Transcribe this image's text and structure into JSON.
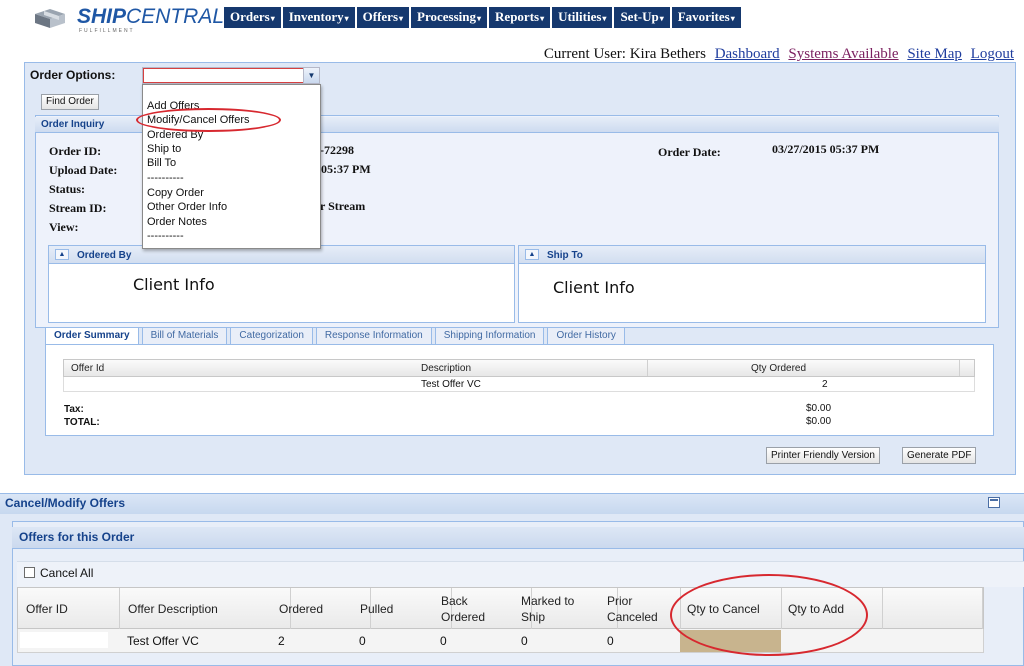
{
  "brand": {
    "name_bold": "SHIP",
    "name_light": "CENTRAL",
    "sub": "FULFILLMENT"
  },
  "nav": [
    {
      "label": "Orders"
    },
    {
      "label": "Inventory"
    },
    {
      "label": "Offers"
    },
    {
      "label": "Processing"
    },
    {
      "label": "Reports"
    },
    {
      "label": "Utilities"
    },
    {
      "label": "Set-Up"
    },
    {
      "label": "Favorites"
    }
  ],
  "userbar": {
    "label": "Current User: Kira Bethers",
    "links": [
      "Dashboard",
      "Systems Available",
      "Site Map",
      "Logout"
    ]
  },
  "order_options": {
    "label": "Order Options:",
    "value": "",
    "menu": [
      "Add Offers",
      "Modify/Cancel Offers",
      "Ordered By",
      "Ship to",
      "Bill To",
      "----------",
      "Copy Order",
      "Other Order Info",
      "Order Notes",
      "----------"
    ]
  },
  "find_order": "Find Order",
  "inquiry": {
    "title": "Order Inquiry",
    "labels": [
      "Order ID:",
      "Upload Date:",
      "Status:",
      "Stream ID:",
      "View:"
    ],
    "order_id_fragment": "-72298",
    "upload_fragment": "05:37 PM",
    "stream_fragment": "r Stream",
    "order_date_label": "Order Date:",
    "order_date": "03/27/2015 05:37 PM"
  },
  "ordered_by": {
    "title": "Ordered By",
    "content": "Client Info"
  },
  "ship_to": {
    "title": "Ship To",
    "content": "Client Info"
  },
  "tabs": [
    "Order Summary",
    "Bill of Materials",
    "Categorization",
    "Response Information",
    "Shipping Information",
    "Order History"
  ],
  "summary": {
    "columns": [
      "Offer Id",
      "Description",
      "Qty Ordered"
    ],
    "rows": [
      {
        "offer_id": "",
        "description": "Test Offer VC",
        "qty": "2"
      }
    ],
    "tax_label": "Tax:",
    "tax": "$0.00",
    "total_label": "TOTAL:",
    "total": "$0.00"
  },
  "buttons": {
    "printer": "Printer Friendly Version",
    "pdf": "Generate PDF"
  },
  "cancel_modify": {
    "title": "Cancel/Modify Offers",
    "section_title": "Offers for this Order",
    "cancel_all": "Cancel All",
    "columns": [
      "Offer ID",
      "Offer Description",
      "Ordered",
      "Pulled",
      "Back Ordered",
      "Marked to Ship",
      "Prior Canceled",
      "Qty to Cancel",
      "Qty to Add"
    ],
    "row": {
      "offer_id": "",
      "description": "Test Offer VC",
      "ordered": "2",
      "pulled": "0",
      "back_ordered": "0",
      "marked_to_ship": "0",
      "prior_canceled": "0",
      "qty_to_cancel": "",
      "qty_to_add": ""
    }
  },
  "colors": {
    "nav_bg": "#15386e",
    "panel_bg": "#dfe8f6",
    "highlight_oval": "#d7282f",
    "qty_cancel_fill": "#c8b48e"
  }
}
